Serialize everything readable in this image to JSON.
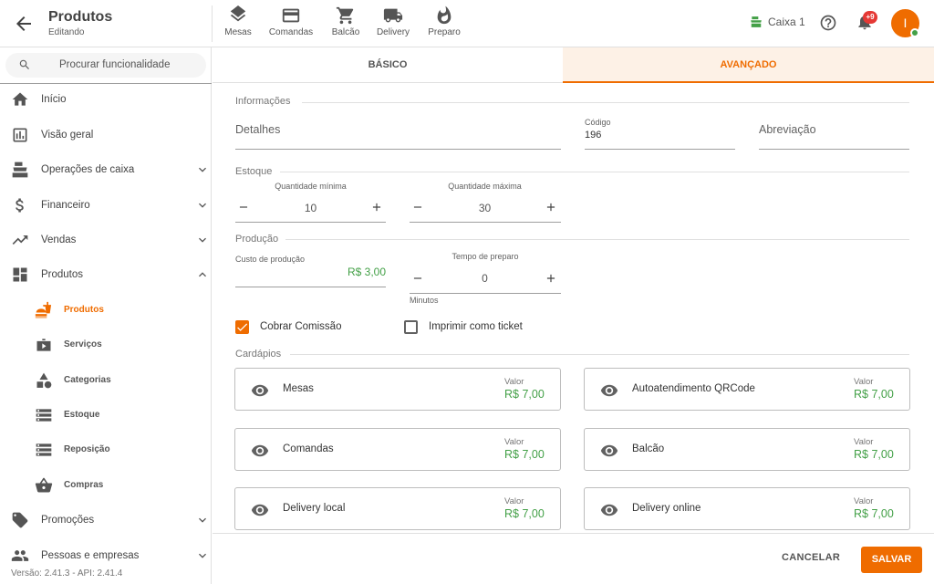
{
  "header": {
    "title": "Produtos",
    "subtitle": "Editando",
    "nav": [
      {
        "label": "Mesas",
        "icon": "layers-icon"
      },
      {
        "label": "Comandas",
        "icon": "card-icon"
      },
      {
        "label": "Balcão",
        "icon": "cart-icon"
      },
      {
        "label": "Delivery",
        "icon": "truck-icon"
      },
      {
        "label": "Preparo",
        "icon": "flame-icon"
      }
    ],
    "caixa": "Caixa 1",
    "notifications": "+9",
    "avatar_initial": "I"
  },
  "sidebar": {
    "search_placeholder": "Procurar funcionalidade",
    "items": [
      {
        "label": "Início",
        "icon": "home-icon"
      },
      {
        "label": "Visão geral",
        "icon": "chart-icon"
      },
      {
        "label": "Operações de caixa",
        "icon": "register-icon"
      },
      {
        "label": "Financeiro",
        "icon": "dollar-icon"
      },
      {
        "label": "Vendas",
        "icon": "trending-icon"
      },
      {
        "label": "Produtos",
        "icon": "dashboard-icon"
      }
    ],
    "subitems": [
      {
        "label": "Produtos",
        "icon": "food-icon",
        "active": true
      },
      {
        "label": "Serviços",
        "icon": "play-icon"
      },
      {
        "label": "Categorias",
        "icon": "shapes-icon"
      },
      {
        "label": "Estoque",
        "icon": "storage-icon"
      },
      {
        "label": "Reposição",
        "icon": "storage-icon"
      },
      {
        "label": "Compras",
        "icon": "basket-icon"
      }
    ],
    "bottom_items": [
      {
        "label": "Promoções",
        "icon": "tag-icon"
      },
      {
        "label": "Pessoas e empresas",
        "icon": "people-icon"
      }
    ],
    "version": "Versão: 2.41.3 - API: 2.41.4"
  },
  "tabs": [
    {
      "label": "BÁSICO",
      "active": false
    },
    {
      "label": "AVANÇADO",
      "active": true
    }
  ],
  "form": {
    "informacoes": {
      "section": "Informações",
      "detalhes_label": "Detalhes",
      "codigo_label": "Código",
      "codigo_value": "196",
      "abreviacao_label": "Abreviação"
    },
    "estoque": {
      "section": "Estoque",
      "min_label": "Quantidade mínima",
      "min_value": "10",
      "max_label": "Quantidade máxima",
      "max_value": "30"
    },
    "producao": {
      "section": "Produção",
      "custo_label": "Custo de produção",
      "custo_value": "R$ 3,00",
      "tempo_label": "Tempo de preparo",
      "tempo_value": "0",
      "tempo_unit": "Minutos"
    },
    "checks": [
      {
        "label": "Cobrar Comissão",
        "checked": true
      },
      {
        "label": "Imprimir como ticket",
        "checked": false
      }
    ],
    "cardapios": {
      "section": "Cardápios",
      "value_label": "Valor",
      "items": [
        {
          "name": "Mesas",
          "value": "R$ 7,00"
        },
        {
          "name": "Autoatendimento QRCode",
          "value": "R$ 7,00"
        },
        {
          "name": "Comandas",
          "value": "R$ 7,00"
        },
        {
          "name": "Balcão",
          "value": "R$ 7,00"
        },
        {
          "name": "Delivery local",
          "value": "R$ 7,00"
        },
        {
          "name": "Delivery online",
          "value": "R$ 7,00"
        }
      ]
    }
  },
  "footer": {
    "cancel_label": "CANCELAR",
    "save_label": "SALVAR"
  },
  "colors": {
    "accent": "#ef6c00",
    "price": "#43a047",
    "badge": "#e53935"
  }
}
